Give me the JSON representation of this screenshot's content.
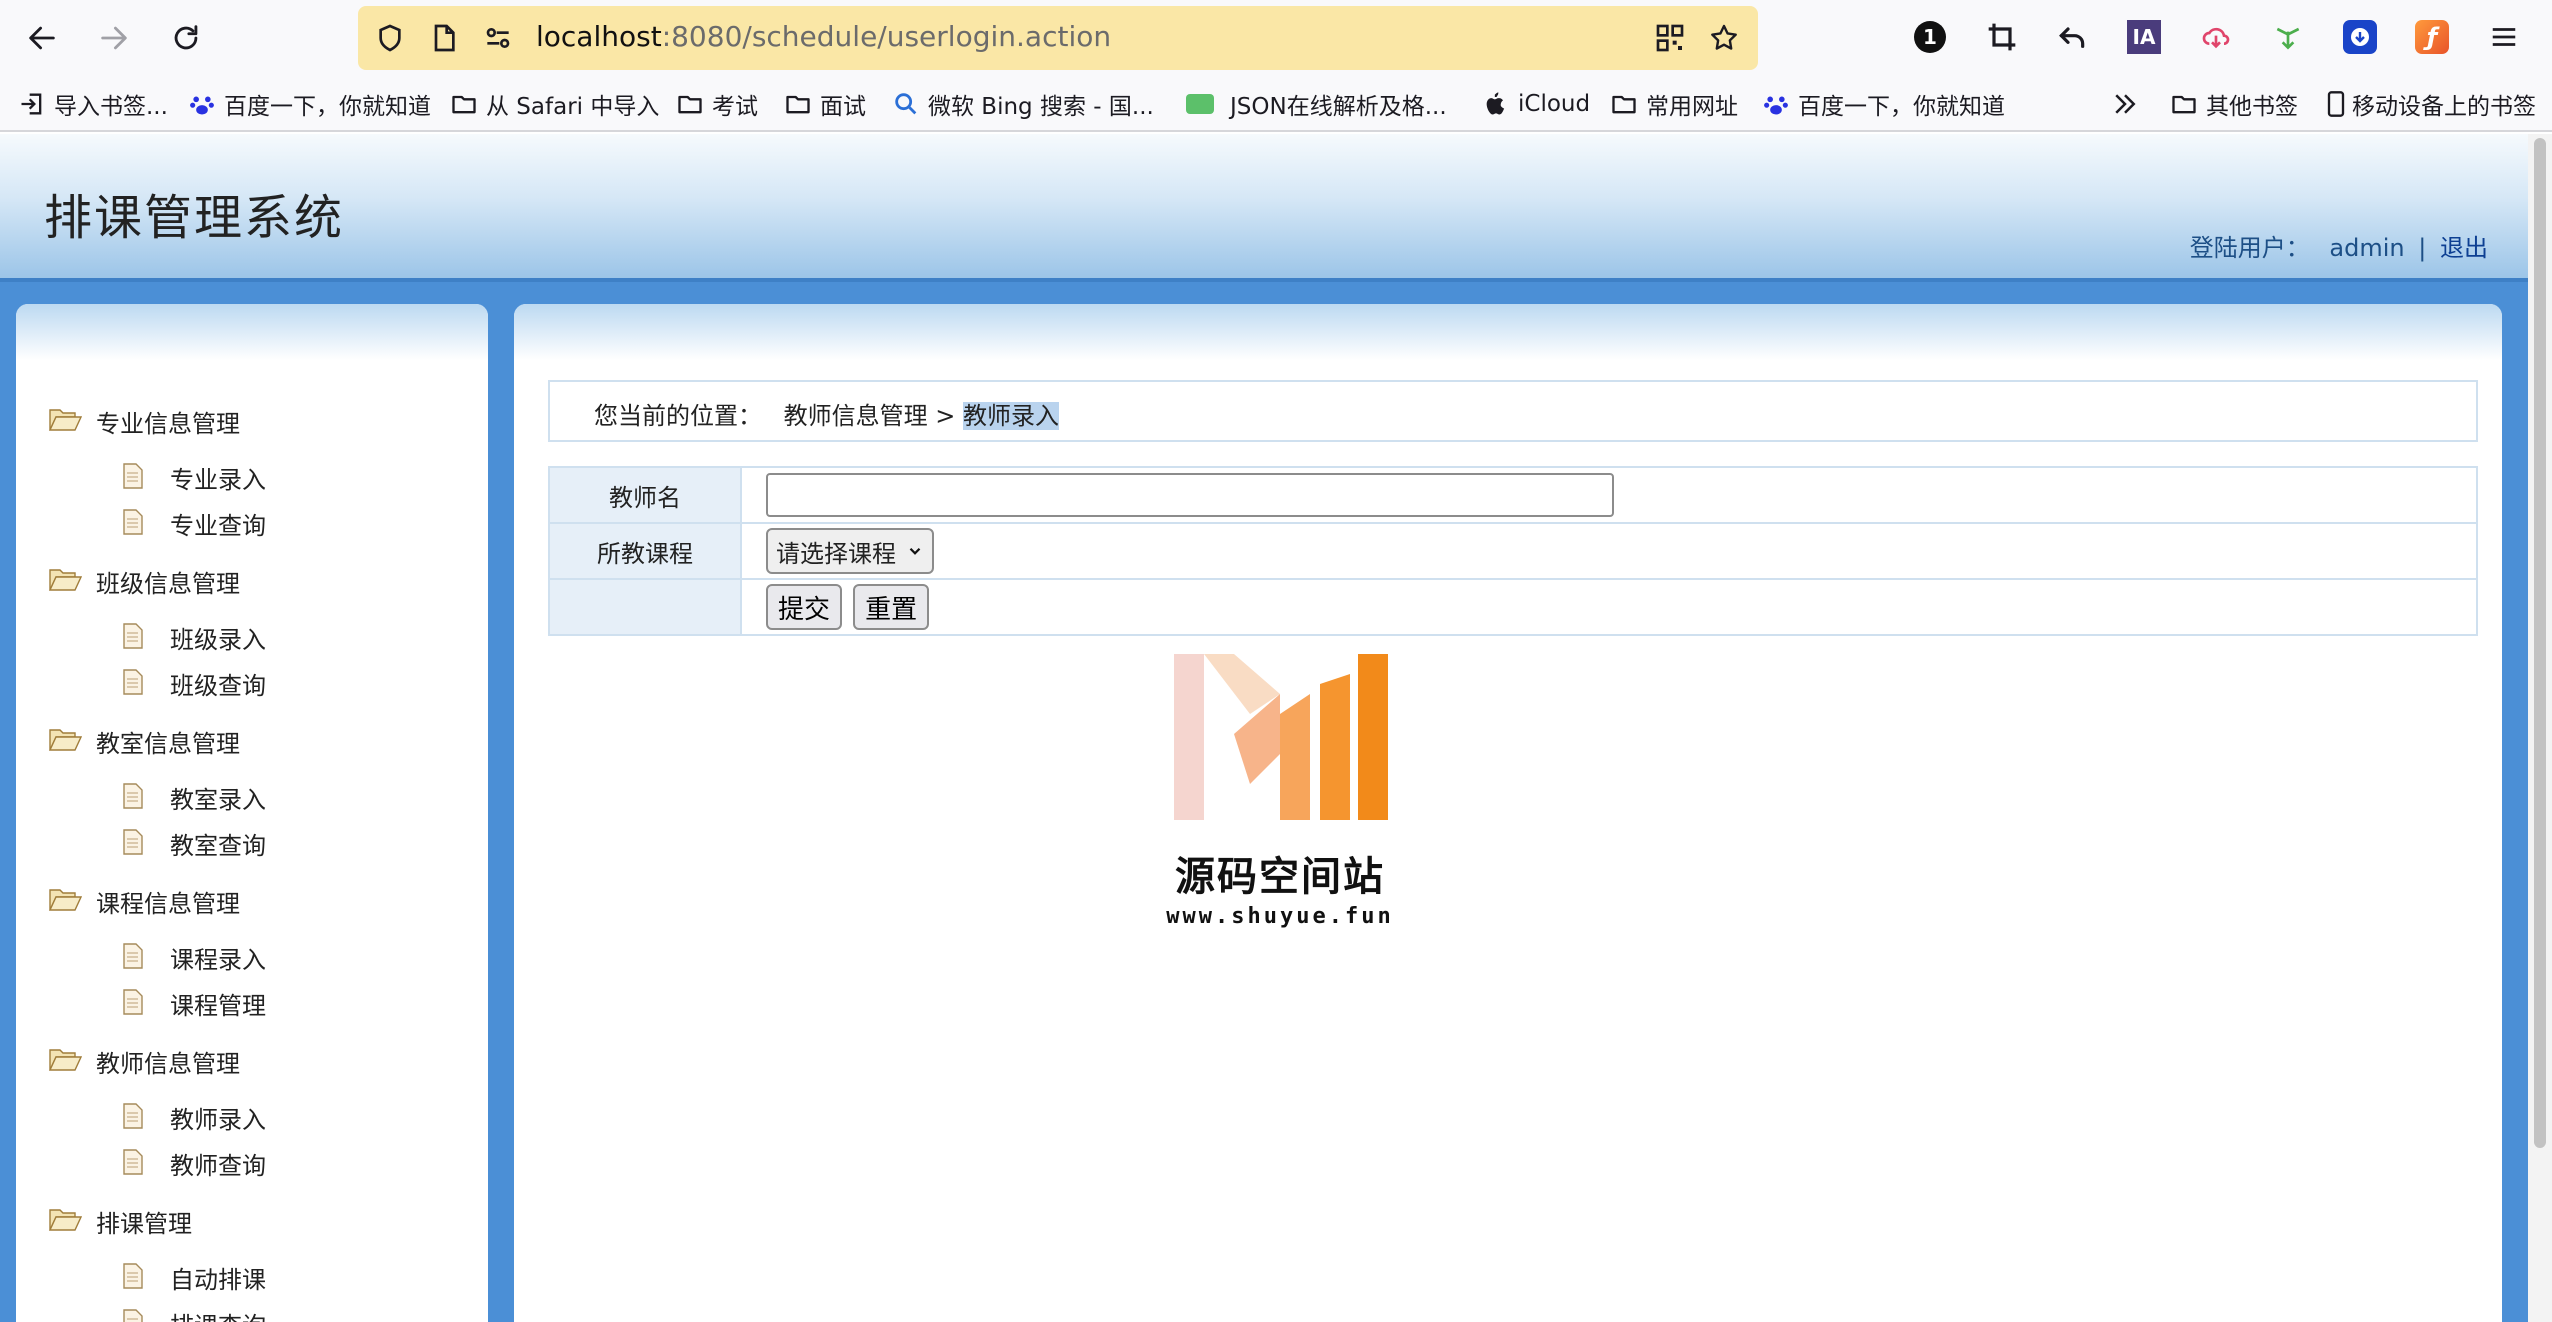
{
  "browser": {
    "url_host": "localhost",
    "url_rest": ":8080/schedule/userlogin.action",
    "extension_badge": "1",
    "extension_ia": "IA"
  },
  "bookmarks": [
    {
      "label": "导入书签...",
      "icon": "import-icon"
    },
    {
      "label": "百度一下，你就知道",
      "icon": "baidu-paw-icon"
    },
    {
      "label": "从 Safari 中导入",
      "icon": "folder-icon"
    },
    {
      "label": "考试",
      "icon": "folder-icon"
    },
    {
      "label": "面试",
      "icon": "folder-icon"
    },
    {
      "label": "微软 Bing 搜索 - 国...",
      "icon": "search-icon"
    },
    {
      "label": "JSON在线解析及格...",
      "icon": "json-icon"
    },
    {
      "label": "iCloud",
      "icon": "apple-icon"
    },
    {
      "label": "常用网址",
      "icon": "folder-icon"
    },
    {
      "label": "百度一下，你就知道",
      "icon": "baidu-paw-icon"
    }
  ],
  "bookmarks_right": {
    "other": "其他书签",
    "mobile": "移动设备上的书签"
  },
  "header": {
    "title": "排课管理系统",
    "user_label": "登陆用户：",
    "user_name": "admin",
    "separator": "|",
    "logout": "退出"
  },
  "sidebar": {
    "groups": [
      {
        "title": "专业信息管理",
        "items": [
          "专业录入",
          "专业查询"
        ]
      },
      {
        "title": "班级信息管理",
        "items": [
          "班级录入",
          "班级查询"
        ]
      },
      {
        "title": "教室信息管理",
        "items": [
          "教室录入",
          "教室查询"
        ]
      },
      {
        "title": "课程信息管理",
        "items": [
          "课程录入",
          "课程管理"
        ]
      },
      {
        "title": "教师信息管理",
        "items": [
          "教师录入",
          "教师查询"
        ]
      },
      {
        "title": "排课管理",
        "items": [
          "自动排课",
          "排课查询"
        ]
      }
    ]
  },
  "breadcrumb": {
    "prefix": "您当前的位置：",
    "parent": "教师信息管理",
    "arrow": ">",
    "current": "教师录入"
  },
  "form": {
    "teacher_label": "教师名",
    "teacher_value": "",
    "course_label": "所教课程",
    "course_selected": "请选择课程",
    "submit": "提交",
    "reset": "重置"
  },
  "watermark": {
    "name": "源码空间站",
    "url": "www.shuyue.fun",
    "colors": [
      "#f5d5cf",
      "#f7a55b",
      "#f28a1a"
    ]
  }
}
